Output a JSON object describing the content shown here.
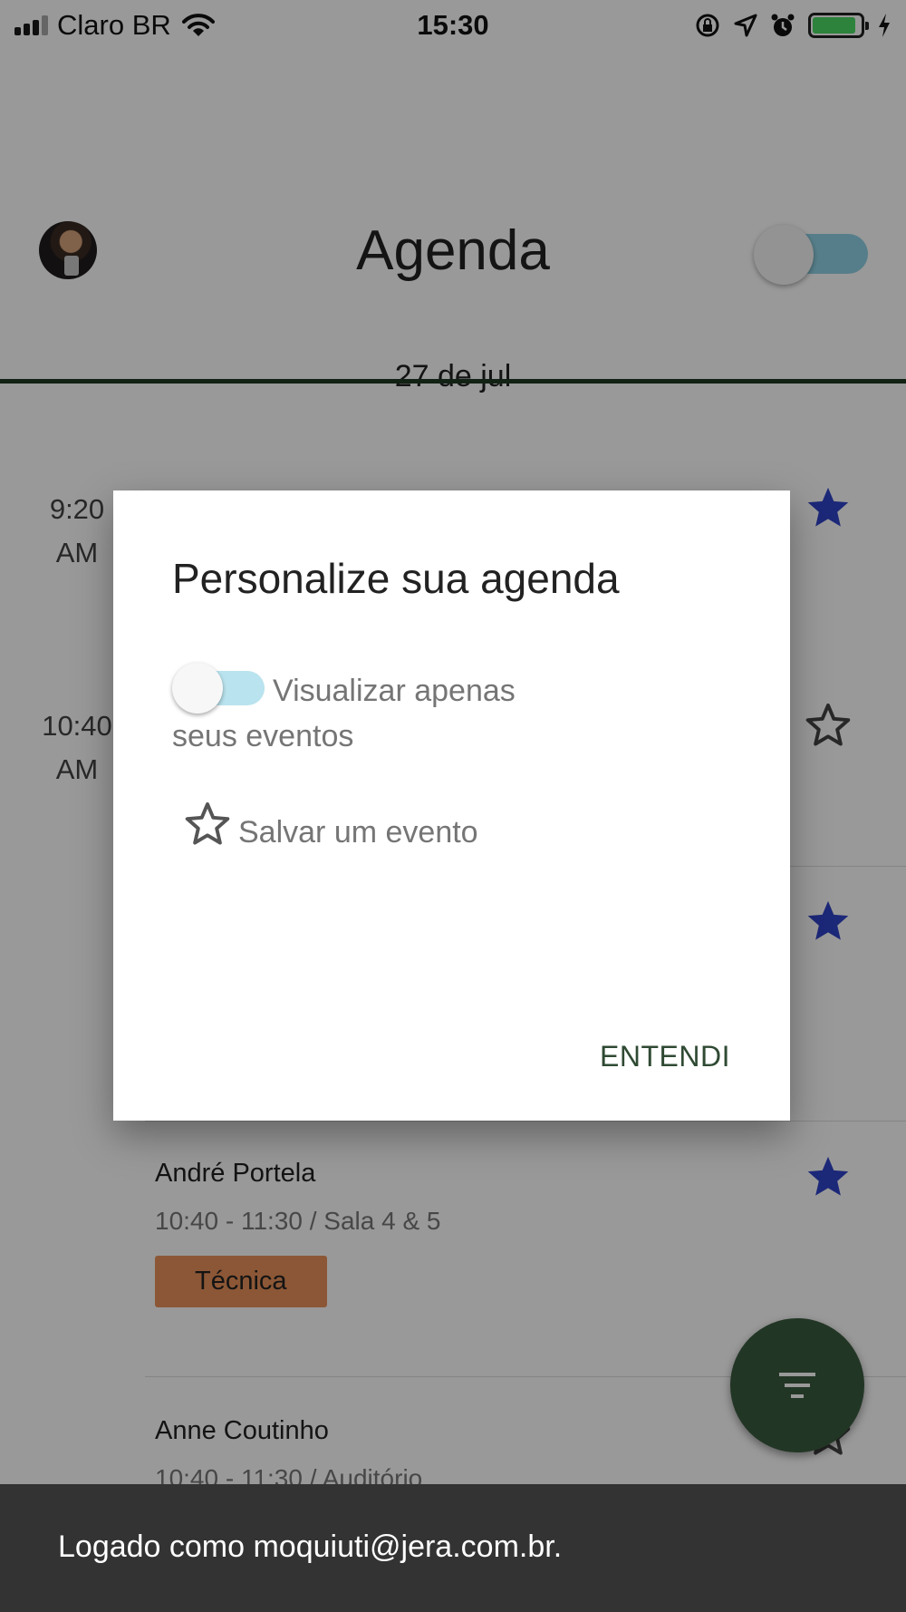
{
  "status_bar": {
    "carrier": "Claro BR",
    "time": "15:30",
    "battery_level_fraction": 0.9,
    "icons": [
      "signal-icon",
      "wifi-icon",
      "rotation-lock-icon",
      "location-icon",
      "alarm-icon",
      "battery-icon",
      "charging-icon"
    ]
  },
  "header": {
    "title": "Agenda",
    "date": "27 de jul",
    "filter_toggle_on": true
  },
  "agenda": {
    "slots": [
      {
        "time": "9:20",
        "period": "AM"
      },
      {
        "time": "10:40",
        "period": "AM"
      }
    ],
    "events": [
      {
        "name": "André Portela",
        "meta": "10:40 - 11:30 / Sala 4 & 5",
        "tag": "Técnica",
        "saved": true
      },
      {
        "name": "Anne Coutinho",
        "meta": "10:40 - 11:30 / Auditório",
        "saved": false
      }
    ],
    "tag_color": "#e9925a",
    "star_color": "#2f43c9"
  },
  "dialog": {
    "title": "Personalize sua agenda",
    "option_toggle_line1": "Visualizar apenas",
    "option_toggle_line2": "seus eventos",
    "option_star": "Salvar um evento",
    "action": "ENTENDI"
  },
  "fab": {
    "icon": "filter-icon"
  },
  "snackbar": {
    "text": "Logado como moquiuti@jera.com.br."
  },
  "colors": {
    "accent_dark_green": "#1f3a23",
    "toggle_track": "#8fd3e6",
    "snackbar_bg": "#333333"
  }
}
